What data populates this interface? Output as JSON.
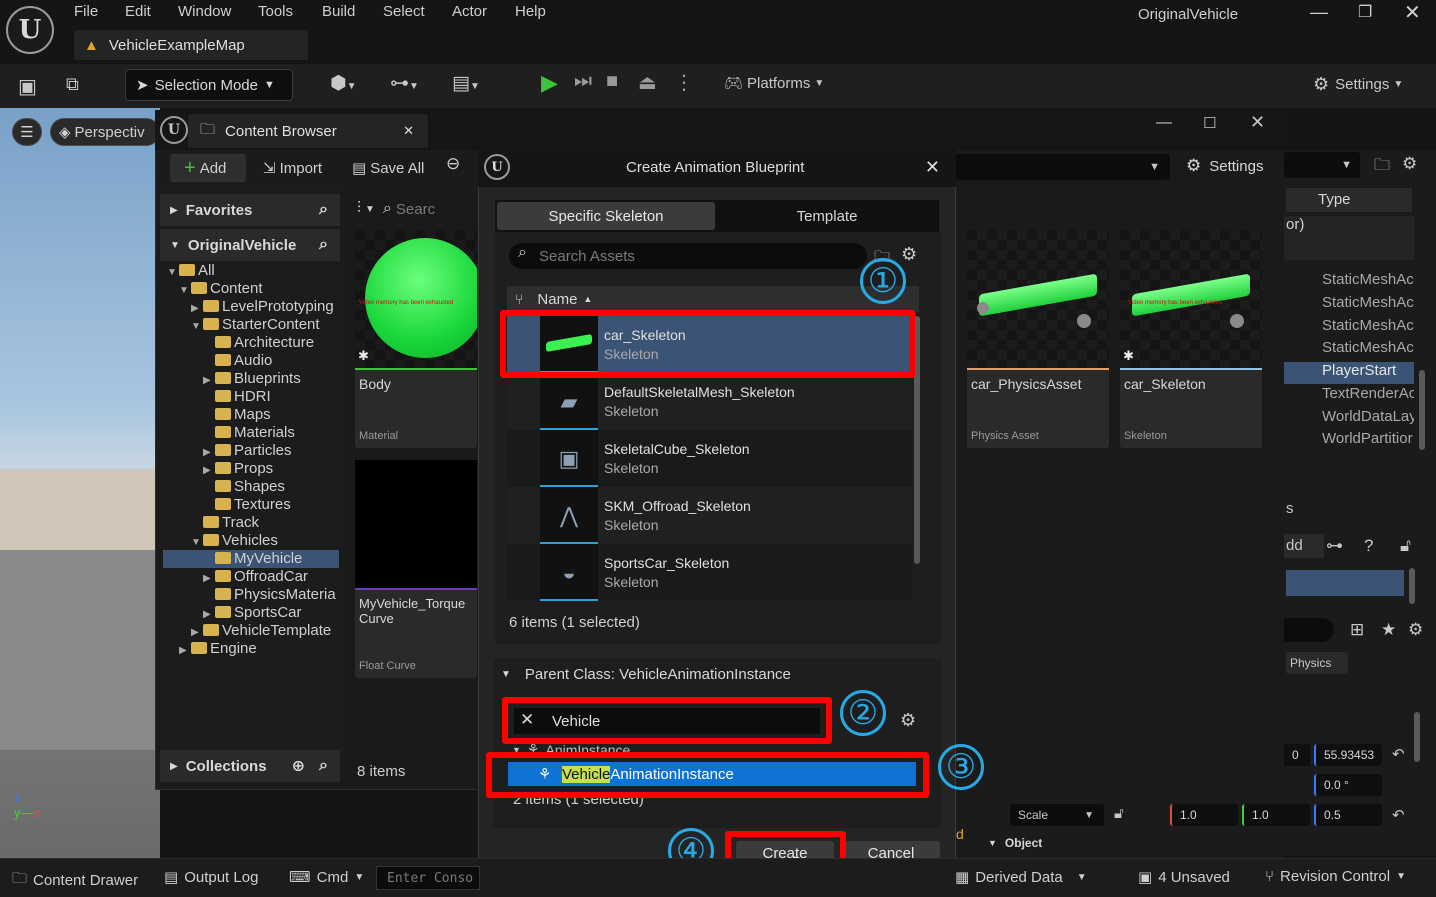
{
  "window": {
    "title": "OriginalVehicle",
    "map_tab": "VehicleExampleMap"
  },
  "menu": [
    "File",
    "Edit",
    "Window",
    "Tools",
    "Build",
    "Select",
    "Actor",
    "Help"
  ],
  "toolbar": {
    "selection_mode": "Selection Mode",
    "platforms": "Platforms",
    "settings": "Settings"
  },
  "viewport": {
    "perspective": "Perspectiv"
  },
  "content_browser": {
    "title": "Content Browser",
    "add": "Add",
    "import": "Import",
    "save_all": "Save All",
    "search_placeholder": "Searc",
    "settings": "Settings",
    "favorites": "Favorites",
    "project": "OriginalVehicle",
    "tree": [
      {
        "label": "All",
        "depth": 0,
        "expanded": true
      },
      {
        "label": "Content",
        "depth": 1,
        "expanded": true
      },
      {
        "label": "LevelPrototyping",
        "depth": 2,
        "expanded": false
      },
      {
        "label": "StarterContent",
        "depth": 2,
        "expanded": true
      },
      {
        "label": "Architecture",
        "depth": 3
      },
      {
        "label": "Audio",
        "depth": 3
      },
      {
        "label": "Blueprints",
        "depth": 3,
        "expanded": false
      },
      {
        "label": "HDRI",
        "depth": 3
      },
      {
        "label": "Maps",
        "depth": 3
      },
      {
        "label": "Materials",
        "depth": 3
      },
      {
        "label": "Particles",
        "depth": 3,
        "expanded": false
      },
      {
        "label": "Props",
        "depth": 3,
        "expanded": false
      },
      {
        "label": "Shapes",
        "depth": 3
      },
      {
        "label": "Textures",
        "depth": 3
      },
      {
        "label": "Track",
        "depth": 2
      },
      {
        "label": "Vehicles",
        "depth": 2,
        "expanded": true
      },
      {
        "label": "MyVehicle",
        "depth": 3,
        "selected": true
      },
      {
        "label": "OffroadCar",
        "depth": 3,
        "expanded": false
      },
      {
        "label": "PhysicsMateria",
        "depth": 3
      },
      {
        "label": "SportsCar",
        "depth": 3,
        "expanded": false
      },
      {
        "label": "VehicleTemplate",
        "depth": 2,
        "expanded": false
      },
      {
        "label": "Engine",
        "depth": 1,
        "expanded": false
      }
    ],
    "collections": "Collections",
    "item_count": "8 items",
    "assets": [
      {
        "name": "Body",
        "type": "Material"
      },
      {
        "name": "MyVehicle_Torque Curve",
        "type": "Float Curve"
      },
      {
        "name": "car_PhysicsAsset",
        "type": "Physics Asset"
      },
      {
        "name": "car_Skeleton",
        "type": "Skeleton"
      }
    ],
    "thumb_warning": "Video memory has been exhausted"
  },
  "right_panel": {
    "type_header": "Type",
    "rows": [
      "or)",
      "",
      "StaticMeshAc",
      "StaticMeshAc",
      "StaticMeshAc",
      "StaticMeshAc",
      "PlayerStart",
      "TextRenderAc",
      "WorldDataLay",
      "WorldPartitior"
    ],
    "s_label": "s",
    "add_label": "dd",
    "physics": "Physics",
    "loc_y": "0",
    "loc_z": "55.93453",
    "rot_z": "0.0 °",
    "scale_label": "Scale",
    "scale_x": "1.0",
    "scale_y": "1.0",
    "scale_z": "0.5",
    "object": "Object",
    "d": "d"
  },
  "dialog": {
    "title": "Create Animation Blueprint",
    "tabs": [
      "Specific Skeleton",
      "Template"
    ],
    "search_placeholder": "Search Assets",
    "column_name": "Name",
    "skeletons": [
      {
        "name": "car_Skeleton",
        "type": "Skeleton",
        "selected": true
      },
      {
        "name": "DefaultSkeletalMesh_Skeleton",
        "type": "Skeleton"
      },
      {
        "name": "SkeletalCube_Skeleton",
        "type": "Skeleton"
      },
      {
        "name": "SKM_Offroad_Skeleton",
        "type": "Skeleton"
      },
      {
        "name": "SportsCar_Skeleton",
        "type": "Skeleton"
      }
    ],
    "skeleton_count": "6 items (1 selected)",
    "parent_class": "Parent Class: VehicleAnimationInstance",
    "filter_value": "Vehicle",
    "anim_instance": "AnimInstance",
    "vehicle_anim_prefix": "Vehicle",
    "vehicle_anim_rest": "AnimationInstance",
    "parent_count": "2 items (1 selected)",
    "create": "Create",
    "cancel": "Cancel"
  },
  "annotations": [
    "①",
    "②",
    "③",
    "④"
  ],
  "statusbar": {
    "content_drawer": "Content Drawer",
    "output_log": "Output Log",
    "cmd": "Cmd",
    "console_placeholder": "Enter Conso",
    "derived_data": "Derived Data",
    "unsaved": "4 Unsaved",
    "revision_control": "Revision Control"
  },
  "colors": {
    "accent_green": "#2ee84a",
    "selection_blue": "#0f73d6",
    "annotation_red": "#ff0000",
    "annotation_blue": "#27a9e6"
  }
}
